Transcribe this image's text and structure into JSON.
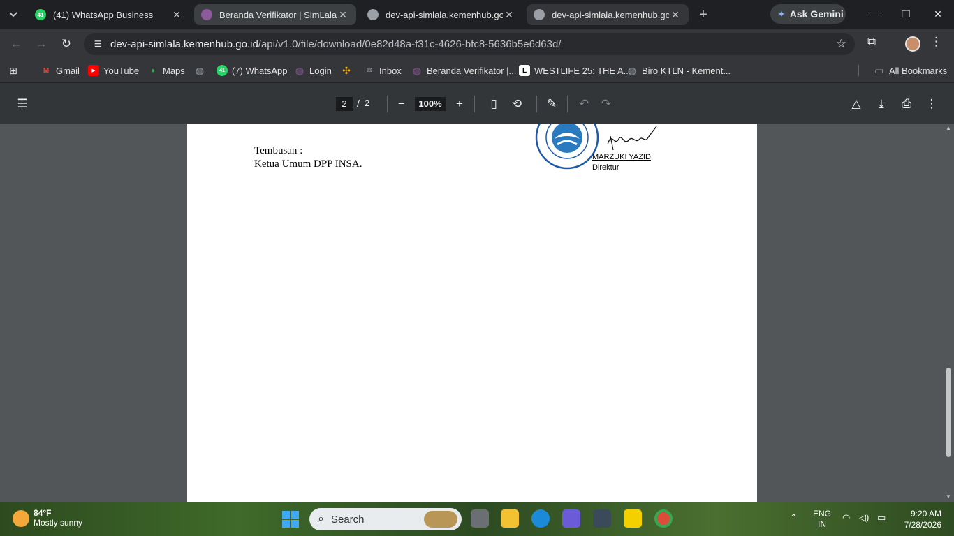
{
  "browser": {
    "tabs": [
      {
        "title": "(41) WhatsApp Business",
        "favicon_text": "41",
        "favicon_color": "#25d366"
      },
      {
        "title": "Beranda Verifikator | SimLala",
        "favicon_text": "",
        "favicon_color": "#8d5a9b"
      },
      {
        "title": "dev-api-simlala.kemenhub.go.id",
        "favicon_text": "",
        "favicon_color": "#9aa0a6"
      },
      {
        "title": "dev-api-simlala.kemenhub.go.id",
        "favicon_text": "",
        "favicon_color": "#9aa0a6"
      }
    ],
    "ask_gemini": "Ask Gemini",
    "url_host": "dev-api-simlala.kemenhub.go.id",
    "url_path": "/api/v1.0/file/download/0e82d48a-f31c-4626-bfc8-5636b5e6d63d/"
  },
  "bookmarks": {
    "items": [
      {
        "label": "Gmail",
        "icon": "gmail-icon",
        "color": "#ea4335"
      },
      {
        "label": "YouTube",
        "icon": "youtube-icon",
        "color": "#ff0000"
      },
      {
        "label": "Maps",
        "icon": "maps-icon",
        "color": "#34a853"
      },
      {
        "label": "",
        "icon": "globe-icon",
        "color": "#9aa0a6"
      },
      {
        "label": "(7) WhatsApp",
        "icon": "whatsapp-icon",
        "color": "#25d366",
        "badge": "41"
      },
      {
        "label": "Login",
        "icon": "globe-icon",
        "color": "#8d5a9b"
      },
      {
        "label": "",
        "icon": "pinwheel-icon",
        "color": "#fbbc04"
      },
      {
        "label": "Inbox",
        "icon": "mail-icon",
        "color": "#9aa0a6"
      },
      {
        "label": "Beranda Verifikator |...",
        "icon": "globe-icon",
        "color": "#8d5a9b"
      },
      {
        "label": "WESTLIFE 25: THE A...",
        "icon": "ticket-icon",
        "color": "#ffffff"
      },
      {
        "label": "Biro KTLN - Kement...",
        "icon": "globe-icon",
        "color": "#9aa0a6"
      }
    ],
    "all_bookmarks": "All Bookmarks"
  },
  "pdf": {
    "current_page": "2",
    "page_separator": "/",
    "total_pages": "2",
    "zoom": "100%",
    "cc_label": "Tembusan :",
    "cc_value": "Ketua Umum DPP INSA.",
    "signer_name": "MARZUKI YAZID",
    "signer_title": "Direktur",
    "stamp_text": "PT. TRI ... JAKARTA"
  },
  "taskbar": {
    "temperature": "84°F",
    "weather": "Mostly sunny",
    "search_placeholder": "Search",
    "lang_line1": "ENG",
    "lang_line2": "IN",
    "time": "9:20 AM",
    "date": "7/28/2026"
  },
  "colors": {
    "tab_active_bg": "#35363a",
    "pdf_toolbar_bg": "#323639",
    "viewer_bg": "#525659"
  }
}
